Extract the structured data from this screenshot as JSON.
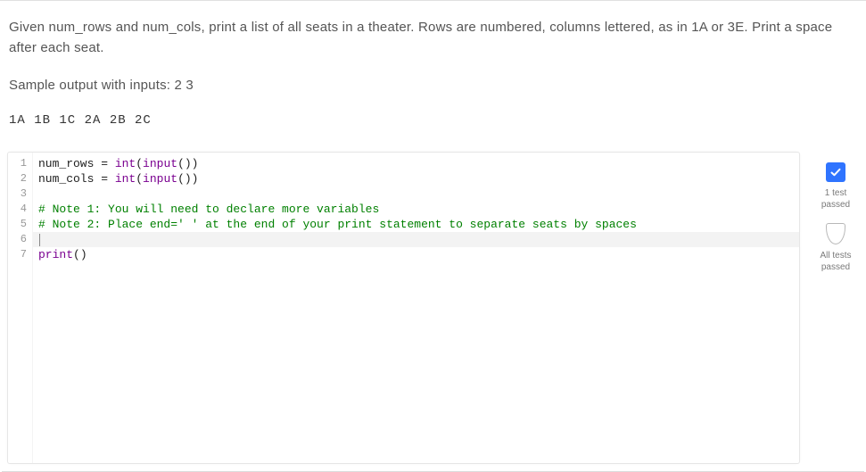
{
  "problem": {
    "description": "Given num_rows and num_cols, print a list of all seats in a theater. Rows are numbered, columns lettered, as in 1A or 3E. Print a space after each seat.",
    "sample_label": "Sample output with inputs: 2 3",
    "sample_output": "1A 1B 1C 2A 2B 2C"
  },
  "editor": {
    "gutter": [
      "1",
      "2",
      "3",
      "4",
      "5",
      "6",
      "7"
    ],
    "lines": {
      "l1": {
        "v1": "num_rows",
        "eq": " = ",
        "fn": "int",
        "op": "(",
        "fn2": "input",
        "cp": "())"
      },
      "l2": {
        "v1": "num_cols",
        "eq": " = ",
        "fn": "int",
        "op": "(",
        "fn2": "input",
        "cp": "())"
      },
      "l3": "",
      "l4": "# Note 1: You will need to declare more variables",
      "l5": "# Note 2: Place end=' ' at the end of your print statement to separate seats by spaces",
      "l6": "",
      "l7": {
        "fn": "print",
        "paren": "()"
      }
    }
  },
  "status": {
    "one_test": "1 test passed",
    "all_tests": "All tests passed"
  }
}
